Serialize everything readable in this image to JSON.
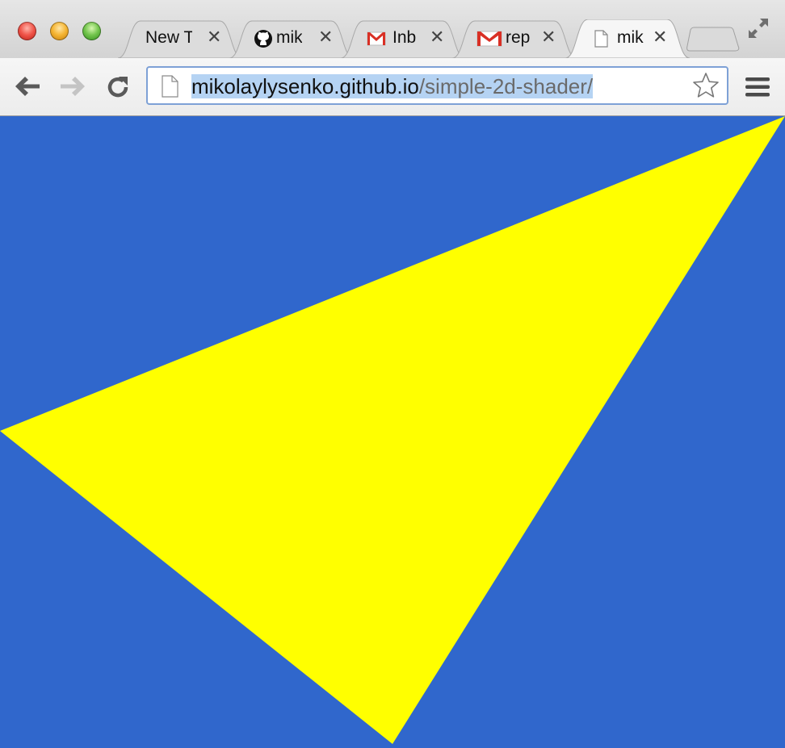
{
  "window": {
    "traffic_lights": [
      "close",
      "minimize",
      "zoom"
    ]
  },
  "tabs": [
    {
      "label": "New T",
      "favicon": "none",
      "active": false
    },
    {
      "label": "mik",
      "favicon": "github-icon",
      "active": false
    },
    {
      "label": "Inb",
      "favicon": "gmail-icon",
      "active": false
    },
    {
      "label": "rep",
      "favicon": "gmail-icon",
      "active": false
    },
    {
      "label": "mik",
      "favicon": "page-icon",
      "active": true
    }
  ],
  "tab_close_glyph": "✕",
  "toolbar": {
    "back": "back-arrow-icon",
    "forward": "forward-arrow-icon",
    "reload": "reload-icon",
    "menu": "hamburger-menu-icon"
  },
  "omnibox": {
    "host": "mikolaylysenko.github.io",
    "path": "/simple-2d-shader/",
    "selected": true
  },
  "content": {
    "background_color": "#3067cc",
    "shape_color": "#ffff00",
    "shape": "triangle"
  }
}
